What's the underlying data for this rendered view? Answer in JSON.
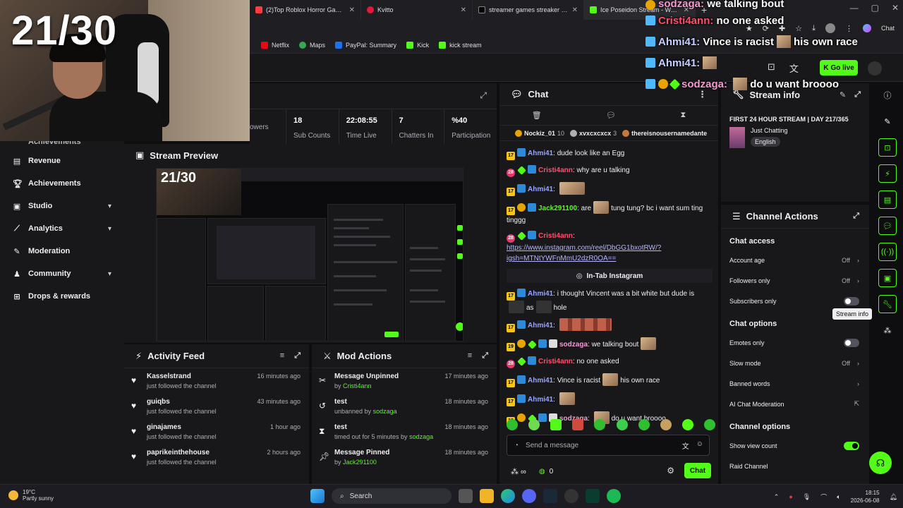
{
  "overlay": {
    "counter": "21/30",
    "chat": [
      {
        "user": "sodzaga:",
        "text": "we talking bout",
        "ucolor": "#f49ad1"
      },
      {
        "user": "Cristi4ann:",
        "text": "no one asked",
        "ucolor": "#ff4f6b"
      },
      {
        "user": "Ahmi41:",
        "text": "Vince is racist",
        "text2": "his own race",
        "ucolor": "#c8cfff"
      },
      {
        "user": "Ahmi41:",
        "text": "",
        "ucolor": "#c8cfff"
      },
      {
        "user": "sodzaga:",
        "text": "do u want broooo",
        "ucolor": "#f49ad1"
      }
    ]
  },
  "browser": {
    "tabs": [
      {
        "title": "(2)Top Roblox Horror Games to Pla",
        "color": "#ff3b3b"
      },
      {
        "title": "Kvitto",
        "color": "#e6173a"
      },
      {
        "title": "streamer games streaker - Search",
        "color": "#111111"
      },
      {
        "title": "Ice Poseidon Stream - Watch Live",
        "color": "#53fc18"
      }
    ],
    "bookmarks": [
      {
        "label": "Netflix",
        "color": "#e50914"
      },
      {
        "label": "Maps",
        "color": "#34a853"
      },
      {
        "label": "PayPal: Summary",
        "color": "#1a73e8"
      },
      {
        "label": "Kick",
        "color": "#53fc18"
      },
      {
        "label": "kick stream",
        "color": "#53fc18"
      }
    ],
    "profile_label": "Chat"
  },
  "header": {
    "go_live": "Go live"
  },
  "stats": [
    {
      "value": "",
      "label": "owers"
    },
    {
      "value": "18",
      "label": "Sub Counts"
    },
    {
      "value": "22:08:55",
      "label": "Time Live"
    },
    {
      "value": "7",
      "label": "Chatters In"
    },
    {
      "value": "%40",
      "label": "Participation"
    }
  ],
  "nav": {
    "partial": "Achievements",
    "items": [
      {
        "label": "Revenue",
        "icon": "revenue-icon",
        "chevron": false
      },
      {
        "label": "Achievements",
        "icon": "trophy-icon",
        "chevron": false
      },
      {
        "label": "Studio",
        "icon": "studio-icon",
        "chevron": true
      },
      {
        "label": "Analytics",
        "icon": "analytics-icon",
        "chevron": true
      },
      {
        "label": "Moderation",
        "icon": "moderation-icon",
        "chevron": false
      },
      {
        "label": "Community",
        "icon": "community-icon",
        "chevron": true
      },
      {
        "label": "Drops & rewards",
        "icon": "drops-icon",
        "chevron": false
      }
    ]
  },
  "preview": {
    "title": "Stream Preview",
    "counter": "21/30"
  },
  "activity": {
    "title": "Activity Feed",
    "items": [
      {
        "name": "Kasselstrand",
        "action": "just followed the channel",
        "time": "16 minutes ago"
      },
      {
        "name": "guiqbs",
        "action": "just followed the channel",
        "time": "43 minutes ago"
      },
      {
        "name": "ginajames",
        "action": "just followed the channel",
        "time": "1 hour ago"
      },
      {
        "name": "paprikeinthehouse",
        "action": "just followed the channel",
        "time": "2 hours ago"
      }
    ]
  },
  "mod": {
    "title": "Mod Actions",
    "items": [
      {
        "name": "Message Unpinned",
        "pre": "by ",
        "by": "Cristi4ann",
        "time": "17 minutes ago",
        "icon": "unpin-icon"
      },
      {
        "name": "test",
        "pre": "unbanned by ",
        "by": "sodzaga",
        "time": "18 minutes ago",
        "icon": "unban-icon"
      },
      {
        "name": "test",
        "pre": "timed out for 5 minutes by ",
        "by": "sodzaga",
        "time": "18 minutes ago",
        "icon": "timeout-icon"
      },
      {
        "name": "Message Pinned",
        "pre": "by ",
        "by": "Jack291100",
        "time": "18 minutes ago",
        "icon": "pin-icon"
      }
    ]
  },
  "chat": {
    "title": "Chat",
    "pinned": [
      {
        "name": "Nockiz_01",
        "count": "10",
        "color": "#e8a400"
      },
      {
        "name": "xvxcxcxcx",
        "count": "3",
        "color": "#b0b0b0"
      },
      {
        "name": "thereisnousernamedante",
        "count": "",
        "color": "#c57a3a"
      }
    ],
    "messages": [
      {
        "badges": [
          "17"
        ],
        "user": "Ahmi41",
        "ucls": "u-ah",
        "text": "dude look like an Egg"
      },
      {
        "badges": [
          "28"
        ],
        "user": "Cristi4ann",
        "ucls": "u-cr",
        "text": "why are u talking"
      },
      {
        "badges": [
          "17"
        ],
        "user": "Ahmi41",
        "ucls": "u-ah",
        "text": "",
        "emote": "w"
      },
      {
        "badges": [
          "17"
        ],
        "user": "Jack291100",
        "ucls": "u-ja",
        "text": "are",
        "emote": "n",
        "text2": "tung tung? bc i want sum ting tinggg"
      },
      {
        "badges": [
          "28"
        ],
        "user": "Cristi4ann",
        "ucls": "u-cr",
        "text": "",
        "link": "https://www.instagram.com/reel/DbGG1bxotRW/?igsh=MTNtYWFnMmU2dzR0OA=="
      }
    ],
    "divider": "In-Tab Instagram",
    "messages2": [
      {
        "badges": [
          "17"
        ],
        "user": "Ahmi41",
        "ucls": "u-ah",
        "text": "i thought Vincent was a bit white but dude is",
        "text2": "as",
        "text3": "hole"
      },
      {
        "badges": [
          "17"
        ],
        "user": "Ahmi41",
        "ucls": "u-ah",
        "text": "",
        "emote": "xw"
      },
      {
        "badges": [
          "19"
        ],
        "user": "sodzaga",
        "ucls": "u-so",
        "text": "we talking bout",
        "emote": "n"
      },
      {
        "badges": [
          "28"
        ],
        "user": "Cristi4ann",
        "ucls": "u-cr",
        "text": "no one asked"
      },
      {
        "badges": [
          "17"
        ],
        "user": "Ahmi41",
        "ucls": "u-ah",
        "text": "Vince is racist",
        "emote": "n",
        "text2": "his own race"
      },
      {
        "badges": [
          "17"
        ],
        "user": "Ahmi41",
        "ucls": "u-ah",
        "text": "",
        "emote": "n"
      },
      {
        "badges": [
          "19"
        ],
        "user": "sodzaga",
        "ucls": "u-so",
        "text": "",
        "emote": "n",
        "text2": "do u want broooo"
      }
    ],
    "input_placeholder": "Send a message",
    "viewers": "0",
    "send_label": "Chat"
  },
  "stream_info": {
    "title": "Stream info",
    "stream_title": "FIRST 24 HOUR STREAM | DAY 217/365",
    "category": "Just Chatting",
    "language": "English"
  },
  "channel_actions": {
    "title": "Channel Actions",
    "chat_access_title": "Chat access",
    "chat_access": [
      {
        "label": "Account age",
        "value": "Off",
        "kind": "chevron"
      },
      {
        "label": "Followers only",
        "value": "Off",
        "kind": "chevron"
      },
      {
        "label": "Subscribers only",
        "value": "",
        "kind": "toggle",
        "on": false
      }
    ],
    "chat_options_title": "Chat options",
    "chat_options": [
      {
        "label": "Emotes only",
        "value": "",
        "kind": "toggle",
        "on": false
      },
      {
        "label": "Slow mode",
        "value": "Off",
        "kind": "chevron"
      },
      {
        "label": "Banned words",
        "value": "",
        "kind": "chevron"
      },
      {
        "label": "AI Chat Moderation",
        "value": "",
        "kind": "external"
      }
    ],
    "channel_options_title": "Channel options",
    "channel_options": [
      {
        "label": "Show view count",
        "value": "",
        "kind": "toggle",
        "on": true
      },
      {
        "label": "Raid Channel",
        "value": "",
        "kind": "none"
      }
    ]
  },
  "tooltip": "Stream info",
  "taskbar": {
    "temp": "19°C",
    "weather": "Partly sunny",
    "search": "Search",
    "time": "18:15",
    "date": "2026-06-08"
  },
  "colors": {
    "accent": "#53fc18",
    "panel": "#18181b",
    "bg": "#0e0e10"
  }
}
